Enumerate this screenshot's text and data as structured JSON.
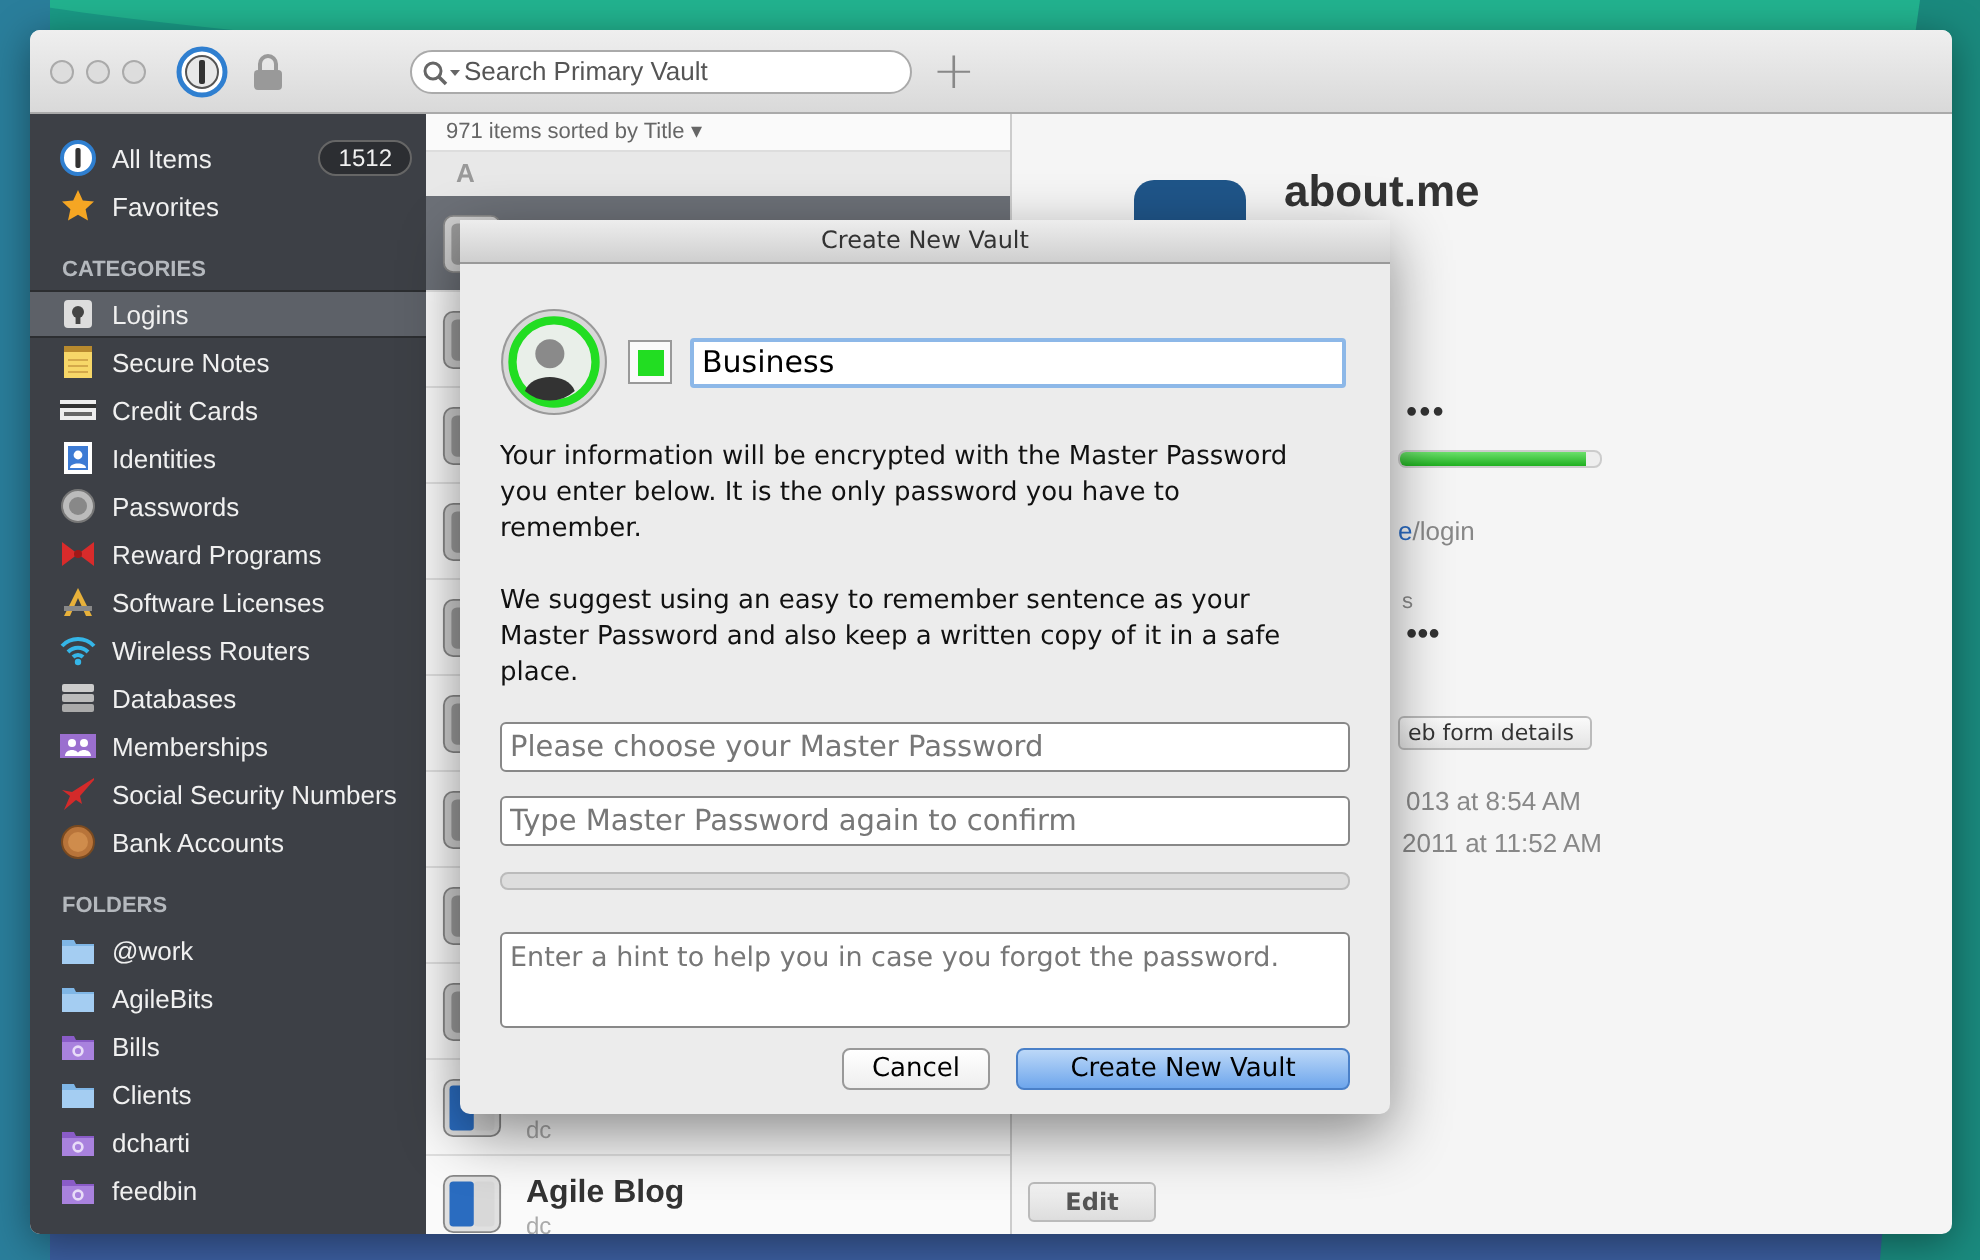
{
  "toolbar": {
    "search": {
      "placeholder": "Search Primary Vault"
    },
    "add_label": "+"
  },
  "sidebar": {
    "top": [
      {
        "label": "All Items",
        "count": "1512",
        "selected": false
      },
      {
        "label": "Favorites",
        "selected": false
      }
    ],
    "categories_heading": "CATEGORIES",
    "categories": [
      {
        "label": "Logins",
        "selected": true
      },
      {
        "label": "Secure Notes",
        "selected": false
      },
      {
        "label": "Credit Cards",
        "selected": false
      },
      {
        "label": "Identities",
        "selected": false
      },
      {
        "label": "Passwords",
        "selected": false
      },
      {
        "label": "Reward Programs",
        "selected": false
      },
      {
        "label": "Software Licenses",
        "selected": false
      },
      {
        "label": "Wireless Routers",
        "selected": false
      },
      {
        "label": "Databases",
        "selected": false
      },
      {
        "label": "Memberships",
        "selected": false
      },
      {
        "label": "Social Security Numbers",
        "selected": false
      },
      {
        "label": "Bank Accounts",
        "selected": false
      }
    ],
    "folders_heading": "FOLDERS",
    "folders": [
      {
        "label": "@work",
        "kind": "folder"
      },
      {
        "label": "AgileBits",
        "kind": "folder"
      },
      {
        "label": "Bills",
        "kind": "smart"
      },
      {
        "label": "Clients",
        "kind": "folder"
      },
      {
        "label": "dcharti",
        "kind": "smart"
      },
      {
        "label": "feedbin",
        "kind": "smart"
      }
    ]
  },
  "list": {
    "summary": "971 items sorted by Title ▾",
    "section": "A",
    "rows": [
      {
        "kind": "login",
        "selected": true
      },
      {
        "kind": "login",
        "selected": false
      },
      {
        "kind": "login",
        "selected": false
      },
      {
        "kind": "login",
        "selected": false
      },
      {
        "kind": "login",
        "selected": false
      },
      {
        "kind": "login",
        "selected": false
      },
      {
        "kind": "login",
        "selected": false
      },
      {
        "kind": "login",
        "selected": false
      },
      {
        "kind": "login",
        "selected": false
      },
      {
        "kind": "app",
        "selected": false,
        "subtitle": "dc"
      },
      {
        "kind": "app",
        "selected": false,
        "title": "Agile Blog",
        "subtitle": "dc"
      }
    ]
  },
  "detail": {
    "title": "about.me",
    "password_dots": "•••",
    "strength": {
      "level": 0.93
    },
    "website": {
      "link": "e",
      "path": "/login"
    },
    "label_fragment": "s",
    "second_dots": "•••",
    "web_form_button": "eb form details",
    "modified": "013 at 8:54 AM",
    "created": "2011 at 11:52 AM",
    "edit_button": "Edit"
  },
  "dialog": {
    "title": "Create New Vault",
    "color": "#22dd22",
    "name_value": "Business",
    "paragraphs": [
      "Your information will be encrypted with the Master Password you enter below. It is the only password you have to remember.",
      "We suggest using an easy to remember sentence as your Master Password and also keep a written copy of it in a safe place."
    ],
    "password_placeholder": "Please choose your Master Password",
    "confirm_placeholder": "Type Master Password again to confirm",
    "strength": {
      "level": 0
    },
    "hint_placeholder": "Enter a hint to help you in case you forgot the password.",
    "buttons": [
      {
        "label": "Cancel",
        "kind": "normal"
      },
      {
        "label": "Create New Vault",
        "kind": "default"
      }
    ]
  }
}
